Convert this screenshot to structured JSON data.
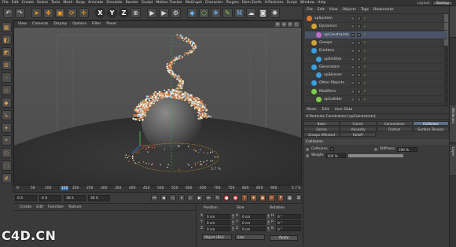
{
  "menubar": {
    "items": [
      "File",
      "Edit",
      "Create",
      "Select",
      "Tools",
      "Mesh",
      "Snap",
      "Animate",
      "Simulate",
      "Render",
      "Sculpt",
      "Motion Tracker",
      "MoGraph",
      "Character",
      "Plugins",
      "Dem Earth",
      "X-Particles",
      "Script",
      "Window",
      "Help"
    ],
    "layout_label": "Layout:",
    "layout_value": "Startup"
  },
  "viewport": {
    "menu": [
      "View",
      "Cameras",
      "Display",
      "Options",
      "Filter",
      "Panel"
    ],
    "distance_label": "5.7 %"
  },
  "timeline": {
    "ticks": [
      "0",
      "50",
      "100",
      "150",
      "200",
      "250",
      "300",
      "350",
      "400",
      "450",
      "500",
      "550",
      "600",
      "650",
      "700",
      "750",
      "800",
      "850",
      "900"
    ],
    "end_label": "5.7 S",
    "current_frame": "150"
  },
  "playback": {
    "start_field": "0 S",
    "current_field": "0 S",
    "end_field": "30 S",
    "end2_field": "30 S"
  },
  "material_manager": {
    "menu": [
      "Create",
      "Edit",
      "Function",
      "Texture"
    ]
  },
  "coordinates": {
    "headers": [
      "Position",
      "Size",
      "Rotation"
    ],
    "rows": [
      {
        "axis": "X",
        "pos": "0 cm",
        "size_axis": "X",
        "size": "0 cm",
        "rot_axis": "H",
        "rot": "0 °"
      },
      {
        "axis": "Y",
        "pos": "0 cm",
        "size_axis": "Y",
        "size": "0 cm",
        "rot_axis": "P",
        "rot": "0 °"
      },
      {
        "axis": "Z",
        "pos": "0 cm",
        "size_axis": "Z",
        "size": "0 cm",
        "rot_axis": "B",
        "rot": "0 °"
      }
    ],
    "mode_dropdown": "Object (Rel)",
    "size_dropdown": "Size",
    "apply_label": "Apply"
  },
  "object_manager": {
    "menu": [
      "File",
      "Edit",
      "View",
      "Objects",
      "Tags",
      "Bookmarks"
    ],
    "objects": [
      {
        "name": "xpSystem",
        "color": "#e07a2a",
        "indent": 0,
        "selected": false
      },
      {
        "name": "Dynamics",
        "color": "#d2a23a",
        "indent": 6,
        "selected": false
      },
      {
        "name": "xpConstraints",
        "color": "#c46acb",
        "indent": 12,
        "selected": true
      },
      {
        "name": "Groups",
        "color": "#d2a23a",
        "indent": 6,
        "selected": false
      },
      {
        "name": "Emitters",
        "color": "#3aa0e0",
        "indent": 6,
        "selected": false
      },
      {
        "name": "xpEmitter",
        "color": "#3aa0e0",
        "indent": 12,
        "selected": false
      },
      {
        "name": "Generators",
        "color": "#3aa0e0",
        "indent": 6,
        "selected": false
      },
      {
        "name": "xpSkinner",
        "color": "#3aa0e0",
        "indent": 12,
        "selected": false
      },
      {
        "name": "Other Objects",
        "color": "#3aa0e0",
        "indent": 6,
        "selected": false
      },
      {
        "name": "Modifiers",
        "color": "#7ccf4d",
        "indent": 6,
        "selected": false
      },
      {
        "name": "xpCollider",
        "color": "#7ccf4d",
        "indent": 12,
        "selected": false
      }
    ]
  },
  "attribute_manager": {
    "menu": [
      "Mode",
      "Edit",
      "User Data"
    ],
    "title": "X-Particles Constraints [xpConstraints]",
    "tabs_row1": [
      "Basic",
      "Coord.",
      "Connections",
      "Collisions"
    ],
    "tabs_row2": [
      "Forces",
      "Viscosity",
      "Friction",
      "Surface Tension"
    ],
    "tabs_row3": [
      "Groups Affected",
      "Falloff"
    ],
    "active_tab": "Collisions",
    "section": "Collisions",
    "collisions_label": "Collisions",
    "collisions_checked": "✓",
    "stiffness_label": "Stiffness",
    "stiffness_value": "100 %",
    "weight_label": "Weight",
    "weight_value": "100 %",
    "weight_fill": 1.0
  },
  "right_tabs": [
    "Attributes",
    "Content Browser",
    "Layer"
  ],
  "watermark": "C4D.CN"
}
